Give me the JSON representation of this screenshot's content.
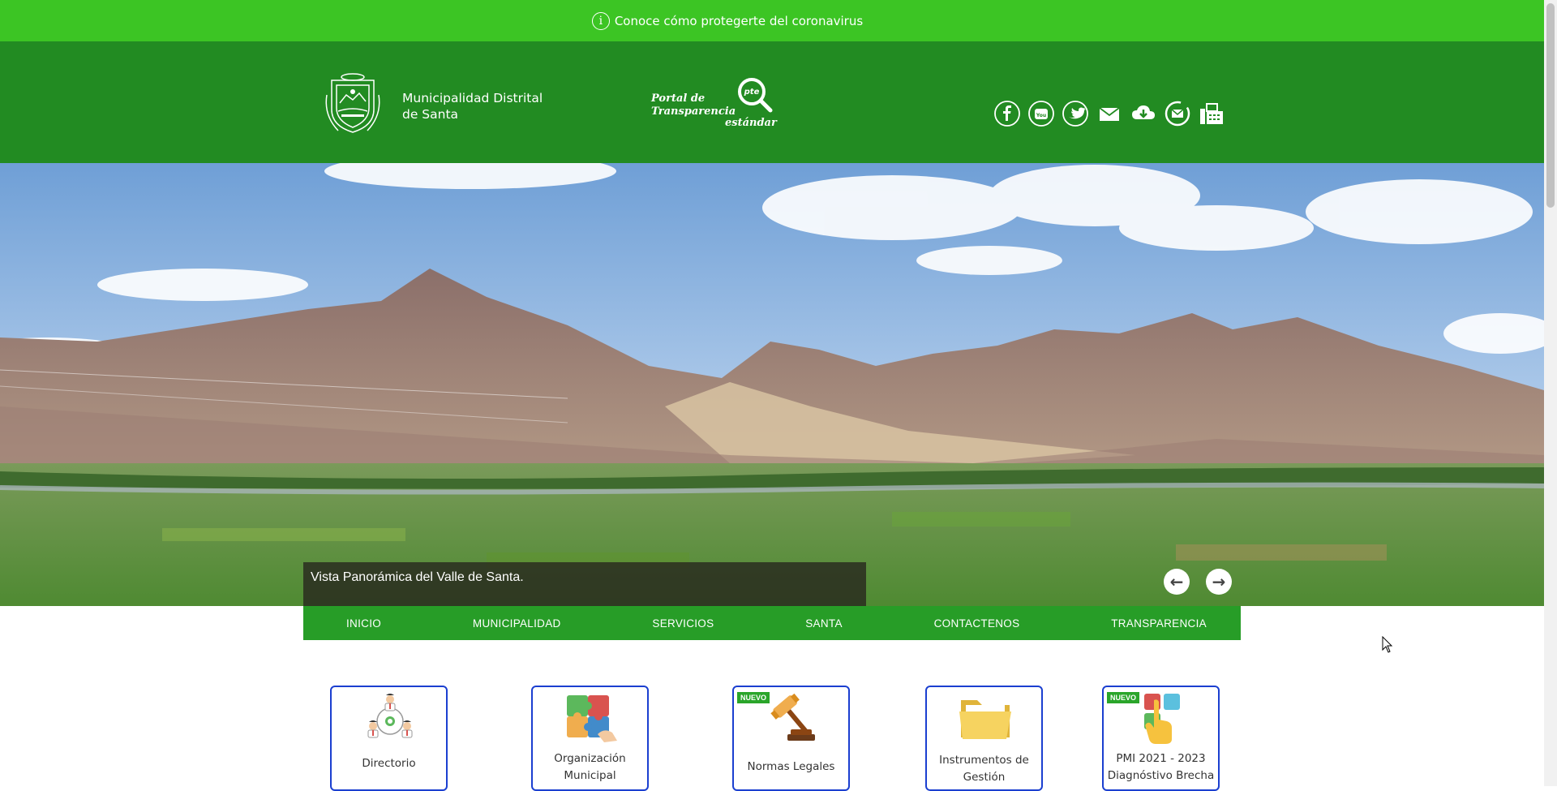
{
  "banner": {
    "text": "Conoce cómo protegerte del coronavirus",
    "icon": "info-icon"
  },
  "header": {
    "brand_line1": "Municipalidad Distrital",
    "brand_line2": "de Santa",
    "portal_line1": "Portal de",
    "portal_line2": "Transparencia",
    "portal_line3": "estándar",
    "portal_badge": "pte",
    "social": [
      "facebook-icon",
      "youtube-icon",
      "twitter-icon",
      "mail-icon",
      "cloud-download-icon",
      "webmail-icon",
      "fax-icon"
    ]
  },
  "slider": {
    "caption": "Vista Panorámica del Valle de Santa."
  },
  "nav": {
    "items": [
      "INICIO",
      "MUNICIPALIDAD",
      "SERVICIOS",
      "SANTA",
      "CONTACTENOS",
      "TRANSPARENCIA"
    ]
  },
  "cards": [
    {
      "label": "Directorio",
      "badge": ""
    },
    {
      "label": "Organización Municipal",
      "badge": ""
    },
    {
      "label": "Normas Legales",
      "badge": "NUEVO"
    },
    {
      "label": "Instrumentos de Gestión",
      "badge": ""
    },
    {
      "label": "PMI 2021 - 2023 Diagnóstivo  Brecha",
      "badge": "NUEVO"
    }
  ],
  "colors": {
    "banner": "#3cc524",
    "header": "#228b22",
    "nav": "#279d27",
    "card_border": "#1b3fd0"
  }
}
